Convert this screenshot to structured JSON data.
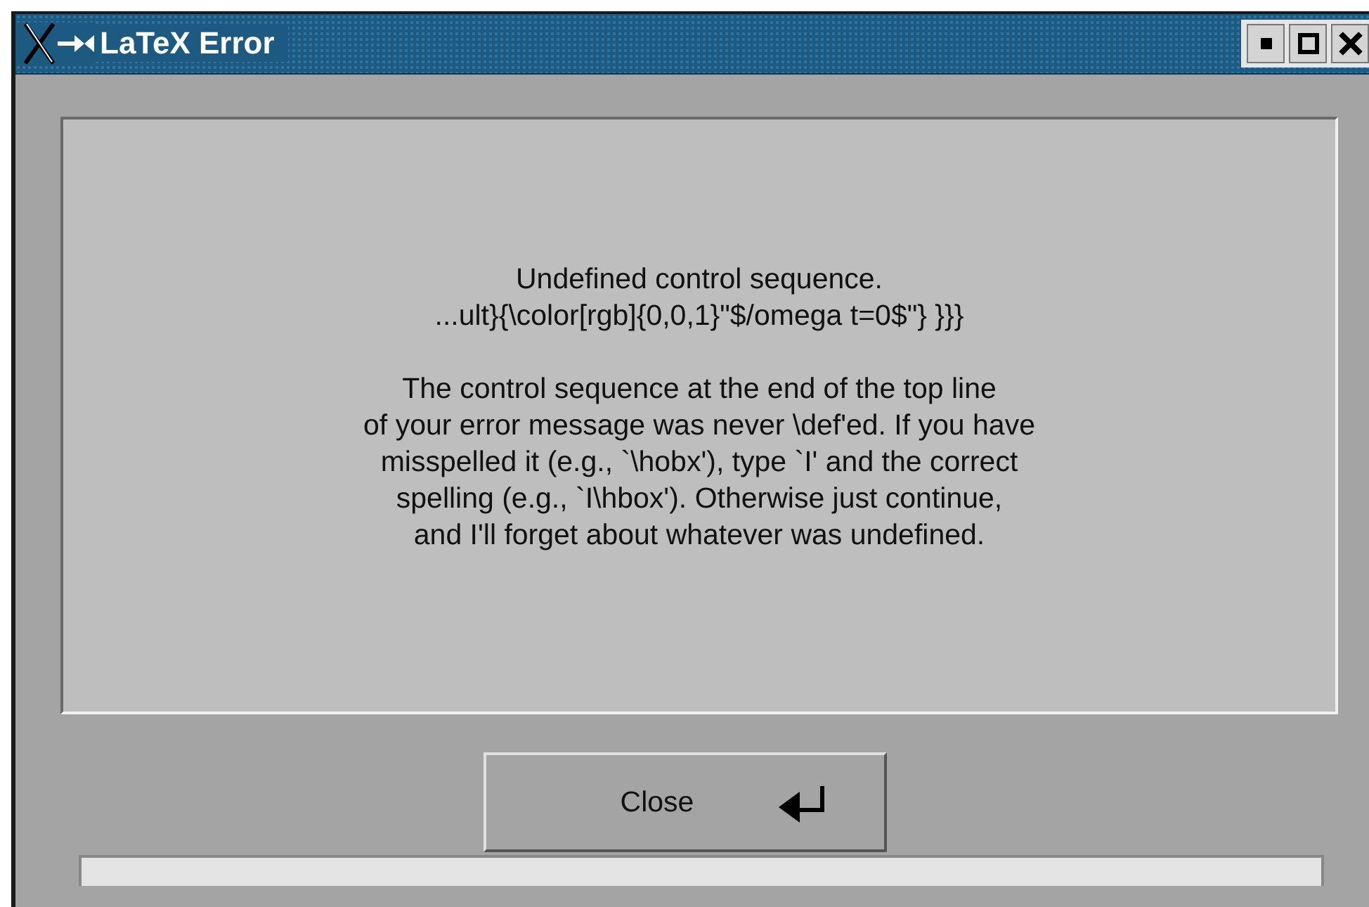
{
  "window": {
    "title": "LaTeX Error"
  },
  "message": {
    "heading_lines": [
      "Undefined control sequence.",
      "...ult}{\\color[rgb]{0,0,1}\"$/omega t=0$\"} }}}"
    ],
    "help_lines": [
      "The control sequence at the end of the top line",
      "of your error message was never \\def'ed. If you have",
      "misspelled it (e.g., `\\hobx'), type `I' and the correct",
      "spelling (e.g., `I\\hbox'). Otherwise just continue,",
      "and I'll forget about whatever was undefined."
    ]
  },
  "buttons": [
    {
      "label": "Close",
      "kind": "default"
    }
  ]
}
